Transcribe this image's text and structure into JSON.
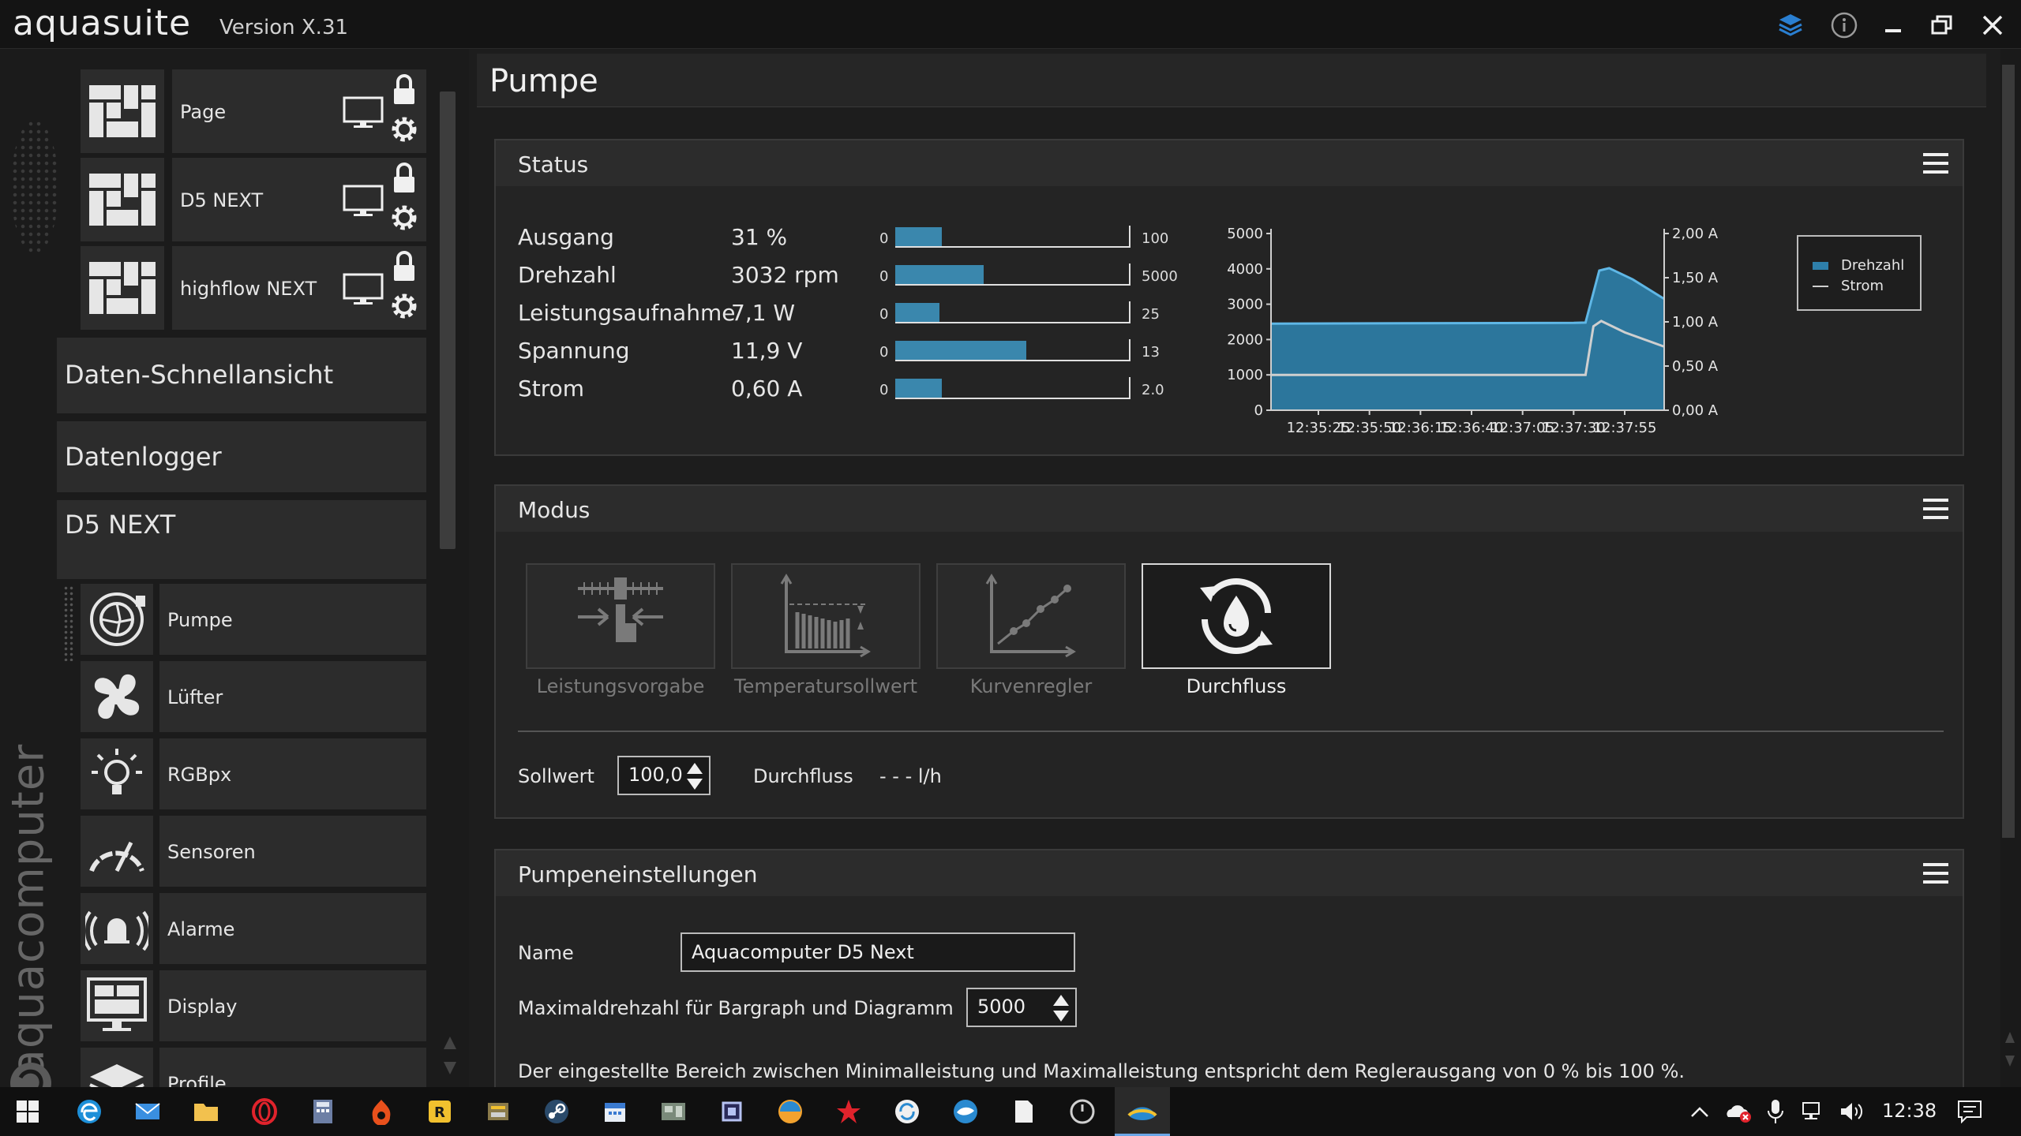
{
  "app": {
    "logo": "aquasuite",
    "version": "Version X.31"
  },
  "window_controls": [
    "layers-icon",
    "info-icon",
    "minimize-icon",
    "restore-icon",
    "close-icon"
  ],
  "sidebar": {
    "pages": [
      {
        "label": "Page"
      },
      {
        "label": "D5 NEXT"
      },
      {
        "label": "highflow NEXT"
      }
    ],
    "sections": [
      {
        "label": "Daten-Schnellansicht"
      },
      {
        "label": "Datenlogger"
      },
      {
        "label": "D5 NEXT"
      }
    ],
    "items": [
      {
        "label": "Pumpe",
        "icon": "pump-icon"
      },
      {
        "label": "Lüfter",
        "icon": "fan-icon"
      },
      {
        "label": "RGBpx",
        "icon": "bulb-icon"
      },
      {
        "label": "Sensoren",
        "icon": "gauge-icon"
      },
      {
        "label": "Alarme",
        "icon": "bell-icon"
      },
      {
        "label": "Display",
        "icon": "display-icon"
      },
      {
        "label": "Profile",
        "icon": "layers-icon"
      }
    ],
    "brand": "aquacomputer"
  },
  "main": {
    "title": "Pumpe",
    "status": {
      "title": "Status",
      "rows": [
        {
          "label": "Ausgang",
          "value": "31 %",
          "min": "0",
          "max": "100",
          "fraction": 0.2
        },
        {
          "label": "Drehzahl",
          "value": "3032 rpm",
          "min": "0",
          "max": "5000",
          "fraction": 0.38
        },
        {
          "label": "Leistungsaufnahme",
          "value": "7,1 W",
          "min": "0",
          "max": "25",
          "fraction": 0.19
        },
        {
          "label": "Spannung",
          "value": "11,9 V",
          "min": "0",
          "max": "13",
          "fraction": 0.56
        },
        {
          "label": "Strom",
          "value": "0,60 A",
          "min": "0",
          "max": "2.0",
          "fraction": 0.2
        }
      ]
    },
    "modus": {
      "title": "Modus",
      "modes": [
        {
          "label": "Leistungsvorgabe",
          "icon": "slider-hand-icon",
          "active": false
        },
        {
          "label": "Temperatursollwert",
          "icon": "temperature-chart-icon",
          "active": false
        },
        {
          "label": "Kurvenregler",
          "icon": "curve-icon",
          "active": false
        },
        {
          "label": "Durchfluss",
          "icon": "flow-icon",
          "active": true
        }
      ],
      "sollwert_label": "Sollwert",
      "sollwert_value": "100,0",
      "durchfluss_label": "Durchfluss",
      "durchfluss_value": "- - - l/h"
    },
    "pump_settings": {
      "title": "Pumpeneinstellungen",
      "name_label": "Name",
      "name_value": "Aquacomputer D5 Next",
      "maxrpm_label": "Maximaldrehzahl für Bargraph und Diagramm",
      "maxrpm_value": "5000",
      "note": "Der eingestellte Bereich zwischen Minimalleistung und Maximalleistung entspricht dem Reglerausgang von 0 % bis 100 %."
    }
  },
  "chart_data": {
    "type": "area",
    "x": [
      "12:35:25",
      "12:35:50",
      "12:36:15",
      "12:36:40",
      "12:37:05",
      "12:37:30",
      "12:37:55"
    ],
    "left_axis": {
      "ticks": [
        "5000",
        "4000",
        "3000",
        "2000",
        "1000",
        "0"
      ],
      "ylim": [
        0,
        5000
      ]
    },
    "right_axis": {
      "ticks": [
        "2,00 A",
        "1,50 A",
        "1,00 A",
        "0,50 A",
        "0,00 A"
      ],
      "ylim": [
        0,
        2
      ]
    },
    "series": [
      {
        "name": "Drehzahl",
        "color": "#2e7faa",
        "points": [
          [
            0,
            2450
          ],
          [
            0.77,
            2470
          ],
          [
            0.8,
            2480
          ],
          [
            0.835,
            3950
          ],
          [
            0.86,
            4020
          ],
          [
            0.92,
            3700
          ],
          [
            1.0,
            3150
          ]
        ]
      },
      {
        "name": "Strom",
        "color": "#cfcfcf",
        "points": [
          [
            0,
            0.4
          ],
          [
            0.8,
            0.4
          ],
          [
            0.82,
            0.95
          ],
          [
            0.84,
            1.01
          ],
          [
            0.9,
            0.88
          ],
          [
            1.0,
            0.72
          ]
        ]
      }
    ],
    "legend": "right",
    "grid": false
  },
  "taskbar": {
    "apps": [
      "windows-start-icon",
      "edge-icon",
      "mail-icon",
      "explorer-icon",
      "opera-icon",
      "calculator-icon",
      "app-red-icon",
      "app-yellow-icon",
      "app-tool-icon",
      "steam-icon",
      "calendar-icon",
      "app-board-icon",
      "app-chip-icon",
      "app-browser-icon",
      "app-red-star-icon",
      "app-sync-icon",
      "app-fish-icon",
      "notepad-icon",
      "app-power-icon",
      "aquasuite-icon"
    ],
    "tray": [
      "chevron-up-icon",
      "onedrive-icon",
      "mic-icon",
      "network-icon",
      "volume-icon"
    ],
    "clock": "12:38",
    "notifications": "notification-icon"
  }
}
